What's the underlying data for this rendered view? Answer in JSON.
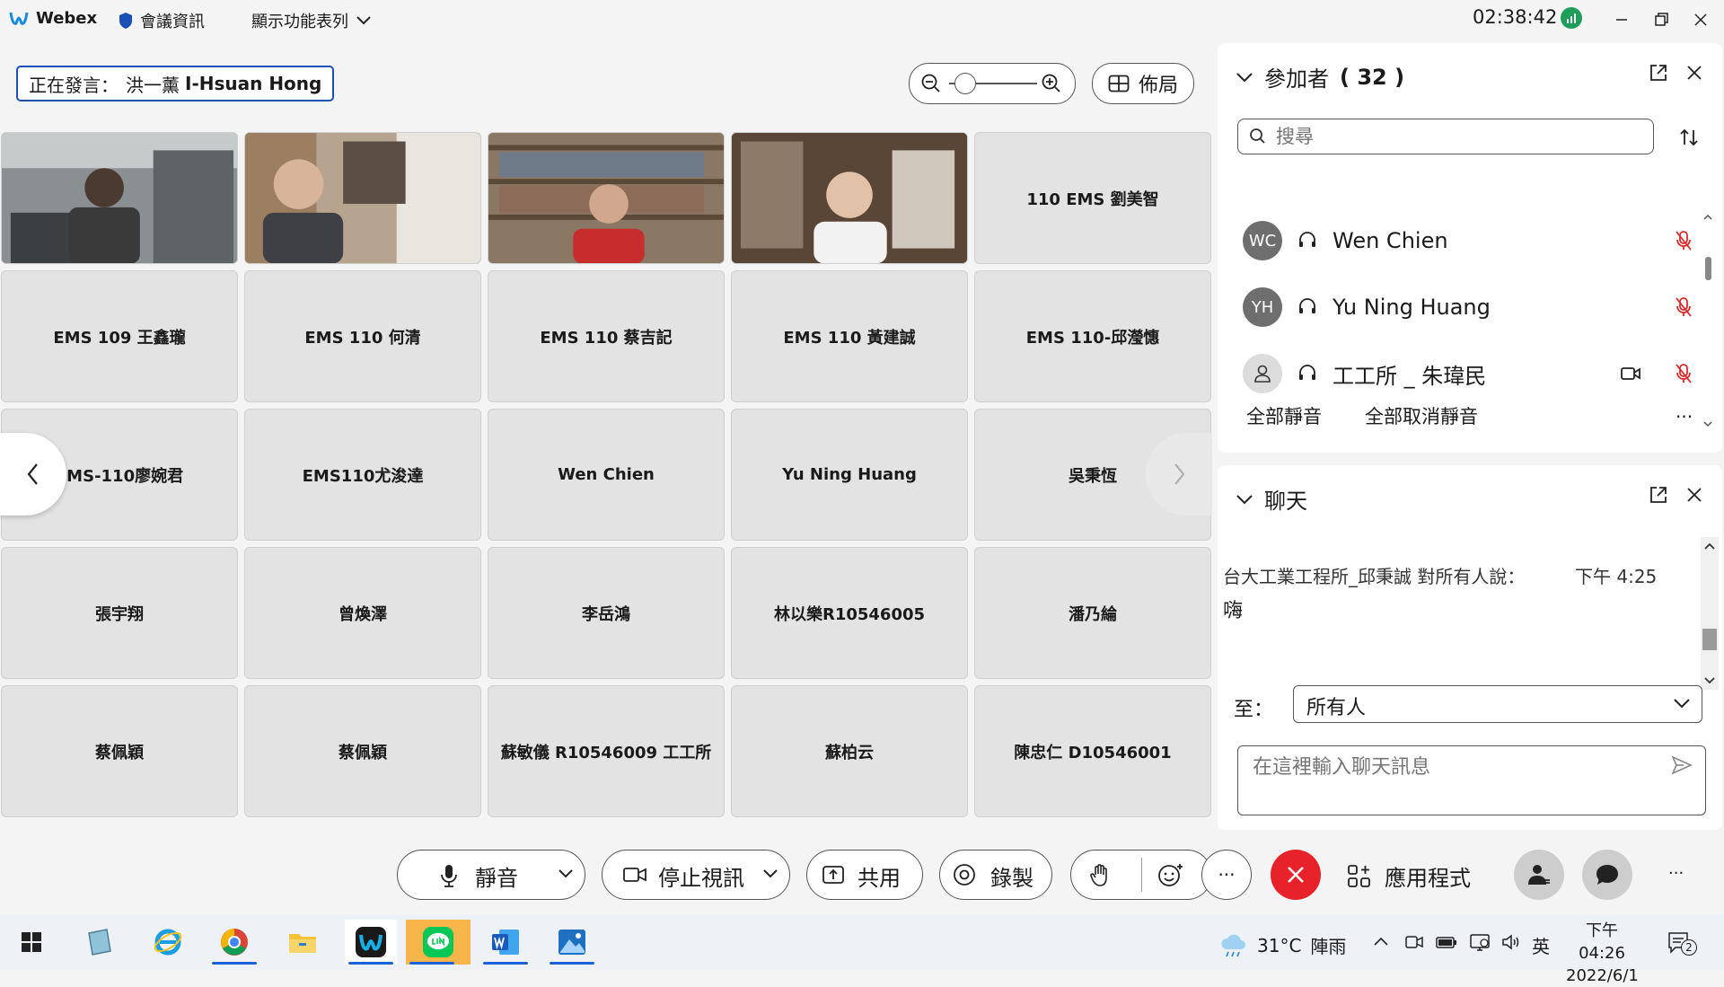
{
  "titlebar": {
    "app_name": "Webex",
    "meeting_info": "會議資訊",
    "show_menu": "顯示功能表列",
    "clock": "02:38:42"
  },
  "speaker": {
    "prefix": "正在發言：",
    "name_zh": "洪一薰",
    "name_en": "I-Hsuan Hong"
  },
  "toolbar": {
    "layout_label": "佈局"
  },
  "grid": {
    "tiles": [
      {
        "label": "",
        "photo": true
      },
      {
        "label": "",
        "photo": true
      },
      {
        "label": "",
        "photo": true
      },
      {
        "label": "",
        "photo": true
      },
      {
        "label": "110 EMS 劉美智"
      },
      {
        "label": "EMS 109 王鑫瓏"
      },
      {
        "label": "EMS 110 何清"
      },
      {
        "label": "EMS 110 蔡吉記"
      },
      {
        "label": "EMS 110 黃建誠"
      },
      {
        "label": "EMS 110-邱瀅憓"
      },
      {
        "label": "EMS-110廖婉君"
      },
      {
        "label": "EMS110尤浚達"
      },
      {
        "label": "Wen Chien"
      },
      {
        "label": "Yu Ning Huang"
      },
      {
        "label": "吳秉恆"
      },
      {
        "label": "張宇翔"
      },
      {
        "label": "曾煥澤"
      },
      {
        "label": "李岳鴻"
      },
      {
        "label": "林以樂R10546005"
      },
      {
        "label": "潘乃綸"
      },
      {
        "label": "蔡佩穎"
      },
      {
        "label": "蔡佩穎"
      },
      {
        "label": "蘇敏儀 R10546009 工工所"
      },
      {
        "label": "蘇柏云"
      },
      {
        "label": "陳忠仁 D10546001"
      }
    ]
  },
  "participants": {
    "title": "參加者",
    "count": "( 32 )",
    "search_placeholder": "搜尋",
    "list": [
      {
        "initials": "WC",
        "name": "Wen Chien"
      },
      {
        "initials": "YH",
        "name": "Yu Ning Huang"
      },
      {
        "initials": "",
        "name": "工工所 _ 朱瑋民"
      }
    ],
    "mute_all": "全部靜音",
    "unmute_all": "全部取消靜音",
    "more": "···"
  },
  "chat": {
    "title": "聊天",
    "message": {
      "header": "台大工業工程所_邱秉誠 對所有人說：",
      "time": "下午 4:25",
      "body": "嗨"
    },
    "to_label": "至：",
    "to_value": "所有人",
    "input_placeholder": "在這裡輸入聊天訊息"
  },
  "controls": {
    "mute": "靜音",
    "stop_video": "停止視訊",
    "share": "共用",
    "record": "錄製",
    "apps": "應用程式",
    "more": "···"
  },
  "taskbar": {
    "temperature": "31°C",
    "weather": "陣雨",
    "ime": "英",
    "time": "下午 04:26",
    "date": "2022/6/1",
    "notifications": "2"
  },
  "colors": {
    "accent": "#1a4fb5",
    "leave": "#e8222a",
    "muted_mic": "#d92b2b"
  }
}
